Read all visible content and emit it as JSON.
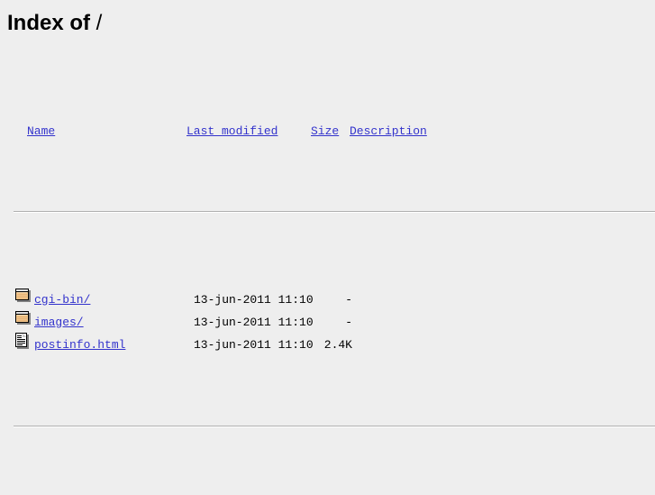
{
  "page": {
    "title_prefix": "Index of ",
    "title_path": "/",
    "background_color": "#eeeeee",
    "link_color": "#3333cc",
    "text_color": "#000000",
    "rule_color": "#b0b0b0"
  },
  "columns": {
    "name": "Name",
    "last_modified": "Last modified",
    "size": "Size",
    "description": "Description"
  },
  "entries": [
    {
      "icon": "folder-icon",
      "name": "cgi-bin/",
      "last_modified": "13-jun-2011 11:10",
      "size": "-",
      "description": ""
    },
    {
      "icon": "folder-icon",
      "name": "images/",
      "last_modified": "13-jun-2011 11:10",
      "size": "-",
      "description": ""
    },
    {
      "icon": "document-icon",
      "name": "postinfo.html",
      "last_modified": "13-jun-2011 11:10",
      "size": "2.4K",
      "description": ""
    }
  ]
}
